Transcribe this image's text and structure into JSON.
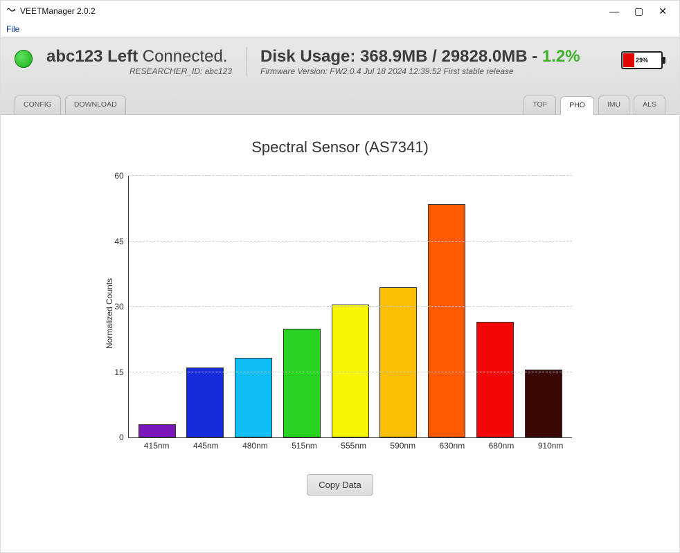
{
  "window": {
    "title": "VEETManager 2.0.2"
  },
  "menubar": {
    "file": "File"
  },
  "win_controls": {
    "min": "—",
    "max": "▢",
    "close": "✕"
  },
  "status": {
    "device_label": "abc123 Left",
    "connected_label": "Connected.",
    "researcher_line": "RESEARCHER_ID: abc123",
    "disk_label": "Disk Usage:",
    "disk_used": "368.9MB",
    "disk_sep": " / ",
    "disk_total": "29828.0MB",
    "disk_dash": " -  ",
    "disk_pct": "1.2%",
    "firmware_line": "Firmware Version: FW2.0.4 Jul 18 2024 12:39:52 First stable release",
    "battery_pct": "29%"
  },
  "tabs_left": [
    "CONFIG",
    "DOWNLOAD"
  ],
  "tabs_right": [
    "TOF",
    "PHO",
    "IMU",
    "ALS"
  ],
  "tabs_right_active": 1,
  "buttons": {
    "copy": "Copy Data"
  },
  "chart_data": {
    "type": "bar",
    "title": "Spectral Sensor (AS7341)",
    "ylabel": "Normalized Counts",
    "xlabel": "",
    "ylim": [
      0,
      60
    ],
    "yticks": [
      0,
      15,
      30,
      45,
      60
    ],
    "categories": [
      "415nm",
      "445nm",
      "480nm",
      "515nm",
      "555nm",
      "590nm",
      "630nm",
      "680nm",
      "910nm"
    ],
    "values": [
      3,
      16,
      18.2,
      25,
      30.5,
      34.5,
      53.5,
      26.5,
      15.5
    ],
    "colors": [
      "#7B16B8",
      "#142CDB",
      "#0FBEF6",
      "#27D31F",
      "#F8F500",
      "#FBBF00",
      "#FF5A00",
      "#F40606",
      "#3A0606"
    ]
  }
}
